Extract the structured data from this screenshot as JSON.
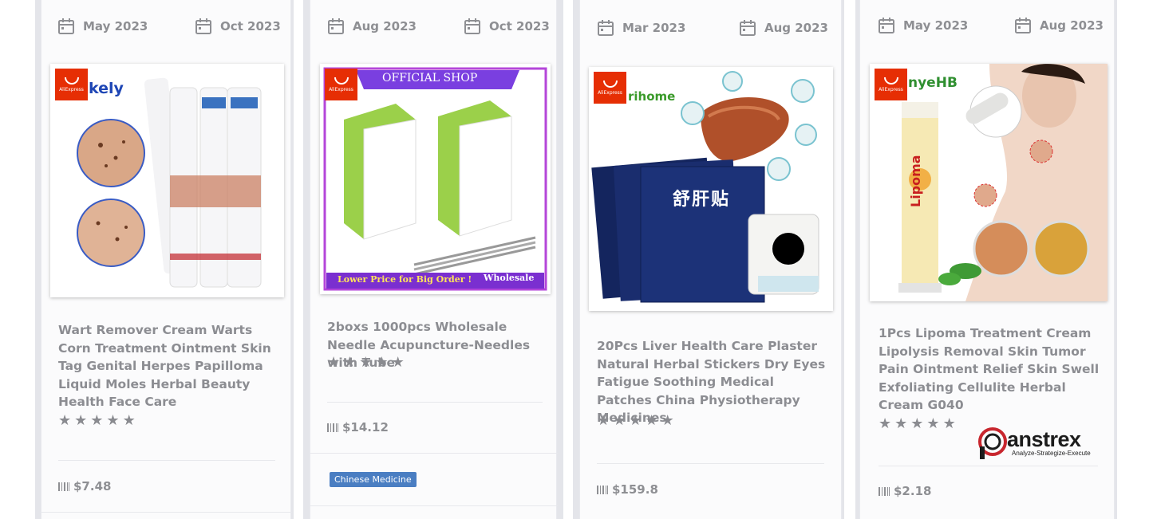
{
  "cards": [
    {
      "start_date": "May 2023",
      "end_date": "Oct 2023",
      "badge_text": "AliExpress",
      "brand_text": "kely",
      "title": "Wart Remover Cream Warts Corn Treatment Ointment Skin Tag Genital Herpes Papilloma Liquid Moles Herbal Beauty Health Face Care",
      "rating": 5,
      "price": "$7.48"
    },
    {
      "start_date": "Aug 2023",
      "end_date": "Oct 2023",
      "badge_text": "AliExpress",
      "banner_top": "OFFICIAL SHOP",
      "banner_bottom": "Lower Price for Big Order !",
      "banner_wholesale": "Wholesale",
      "title": "2boxs 1000pcs Wholesale Needle Acupuncture-Needles with Tube",
      "rating": 5,
      "price": "$14.12",
      "tag": "Chinese Medicine"
    },
    {
      "start_date": "Mar 2023",
      "end_date": "Aug 2023",
      "badge_text": "AliExpress",
      "brand_text": "rihome",
      "package_text": "舒肝贴",
      "title": "20Pcs Liver Health Care Plaster Natural Herbal Stickers Dry Eyes Fatigue Soothing Medical Patches China Physiotherapy Medicines",
      "rating": 5,
      "price": "$159.8"
    },
    {
      "start_date": "May 2023",
      "end_date": "Aug 2023",
      "badge_text": "AliExpress",
      "brand_text": "nyeHB",
      "tube_text": "Lipoma",
      "title": "1Pcs Lipoma Treatment Cream Lipolysis Removal Skin Tumor Pain Ointment Relief Skin Swell Exfoliating Cellulite Herbal Cream G040",
      "rating": 5,
      "price": "$2.18"
    }
  ],
  "watermark": {
    "name": "anstrex",
    "tagline": "Analyze-Strategize-Execute"
  },
  "colors": {
    "text_gray": "#8c8d92",
    "tag_blue": "#4a7ec2",
    "aliexpress_red": "#e62e04"
  }
}
